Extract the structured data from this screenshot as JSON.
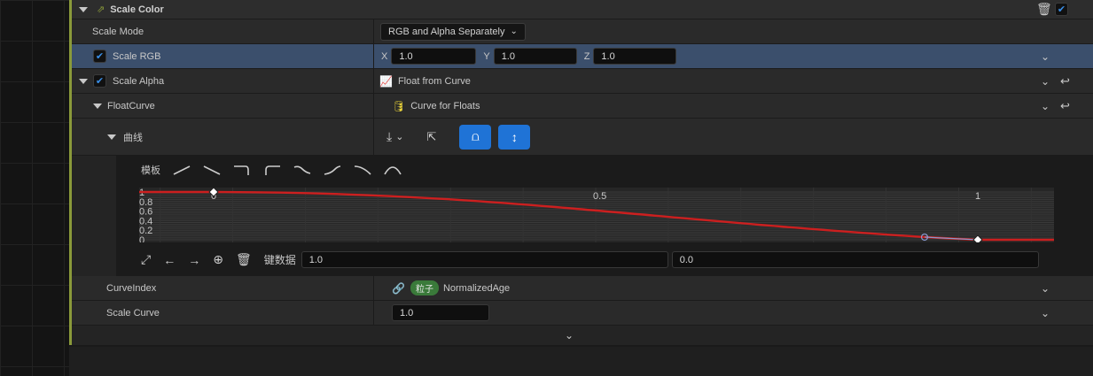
{
  "header": {
    "title": "Scale Color"
  },
  "scale_mode": {
    "label": "Scale Mode",
    "value": "RGB and Alpha Separately"
  },
  "scale_rgb": {
    "label": "Scale RGB",
    "x_label": "X",
    "x_value": "1.0",
    "y_label": "Y",
    "y_value": "1.0",
    "z_label": "Z",
    "z_value": "1.0"
  },
  "scale_alpha": {
    "label": "Scale Alpha",
    "value": "Float from Curve"
  },
  "float_curve": {
    "label": "FloatCurve",
    "value": "Curve for Floats"
  },
  "curve": {
    "label": "曲线",
    "template_label": "模板",
    "y_ticks": [
      "1",
      "0.8",
      "0.6",
      "0.4",
      "0.2",
      "0"
    ],
    "x_ticks": [
      "0",
      "0.5",
      "1"
    ],
    "key_data_label": "键数据",
    "key_time": "1.0",
    "key_value": "0.0",
    "points": [
      {
        "time": 0.0,
        "value": 1.0
      },
      {
        "time": 1.0,
        "value": 0.0
      }
    ]
  },
  "curve_index": {
    "label": "CurveIndex",
    "badge": "粒子",
    "value": "NormalizedAge"
  },
  "scale_curve": {
    "label": "Scale Curve",
    "value": "1.0"
  },
  "colors": {
    "accent": "#1f73d6",
    "curve": "#cc1f1f",
    "highlight": "#3b4f6c"
  }
}
